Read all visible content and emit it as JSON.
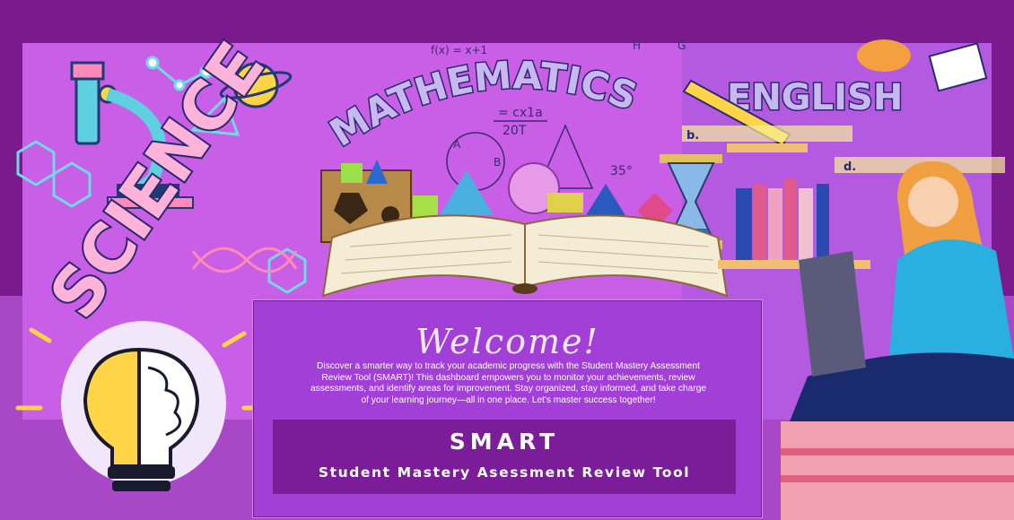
{
  "banner": {
    "subjects": {
      "science": "SCIENCE",
      "mathematics": "MATHEMATICS",
      "english": "ENGLISH"
    },
    "math_doodles": {
      "formula_top": "f(x) = x+1",
      "fraction_num": "= cx1a",
      "fraction_den": "20T",
      "angle": "35°",
      "letter_a": "A",
      "letter_b": "B",
      "letter_h": "H",
      "letter_g": "G"
    },
    "english_doodles": {
      "option_b": "b.",
      "option_d": "d."
    }
  },
  "welcome": {
    "heading": "Welcome!",
    "body": "Discover a smarter way to track your academic progress with the Student Mastery Assessment Review Tool (SMART)! This dashboard empowers you to monitor your achievements, review assessments, and identify areas for improvement. Stay organized, stay informed, and take charge of your learning journey—all in one place. Let's master success together!"
  },
  "brand": {
    "title": "SMART",
    "subtitle": "Student Mastery Asessment Review Tool"
  },
  "colors": {
    "frame": "#7a1a8c",
    "panel": "#c85fe6",
    "card": "#a13fd6",
    "smart_box": "#7b1c98",
    "text": "#ffffff"
  },
  "icons": [
    "microscope-icon",
    "planet-icon",
    "lightbulb-brain-icon",
    "open-book-icon",
    "hourglass-icon",
    "dna-icon",
    "student-laptop-icon",
    "bookshelf-icon",
    "brain-icon"
  ]
}
